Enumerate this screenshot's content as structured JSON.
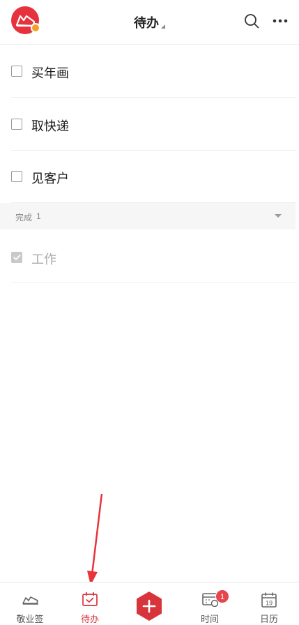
{
  "header": {
    "title": "待办"
  },
  "todos": [
    {
      "text": "买年画",
      "done": false
    },
    {
      "text": "取快递",
      "done": false
    },
    {
      "text": "见客户",
      "done": false
    }
  ],
  "completed": {
    "label": "完成",
    "count": "1",
    "items": [
      {
        "text": "工作",
        "done": true
      }
    ]
  },
  "tabbar": {
    "tabs": [
      {
        "label": "敬业签",
        "icon": "cloud-note-icon",
        "active": false
      },
      {
        "label": "待办",
        "icon": "calendar-check-icon",
        "active": true
      },
      {
        "label": "",
        "icon": "plus-hexagon-icon",
        "active": false
      },
      {
        "label": "时间",
        "icon": "time-calendar-icon",
        "active": false,
        "badge": "1"
      },
      {
        "label": "日历",
        "icon": "calendar-19-icon",
        "active": false,
        "day": "19"
      }
    ]
  },
  "colors": {
    "accent": "#d8343b",
    "brand_avatar": "#e5323c",
    "badge": "#e5454c"
  }
}
